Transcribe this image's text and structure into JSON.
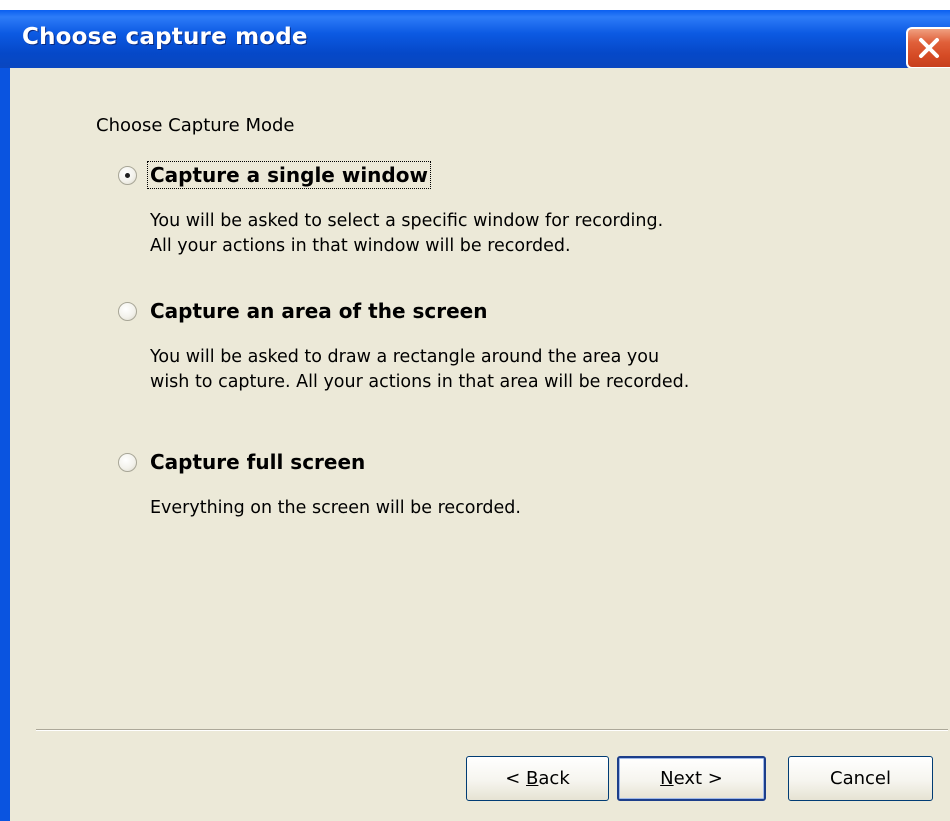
{
  "window": {
    "title": "Choose capture mode",
    "close_icon": "close-x-icon"
  },
  "content": {
    "heading": "Choose Capture Mode",
    "options": [
      {
        "label": "Capture a single window",
        "selected": true,
        "description": [
          "You will be asked to select a specific window for recording.",
          "All your actions in that window will be recorded."
        ]
      },
      {
        "label": "Capture an area of the screen",
        "selected": false,
        "description": [
          "You will be asked to draw a rectangle around the area you",
          "wish to capture. All your actions in that area will be recorded."
        ]
      },
      {
        "label": "Capture full screen",
        "selected": false,
        "description": [
          "Everything on the screen will be recorded."
        ]
      }
    ]
  },
  "buttons": {
    "back": {
      "prefix": "< ",
      "mnemonic": "B",
      "rest": "ack"
    },
    "next": {
      "mnemonic": "N",
      "rest": "ext >"
    },
    "cancel": "Cancel"
  },
  "colors": {
    "titlebar": "#0a54e0",
    "dialog_bg": "#ece9d8",
    "close_button": "#d54b25"
  }
}
